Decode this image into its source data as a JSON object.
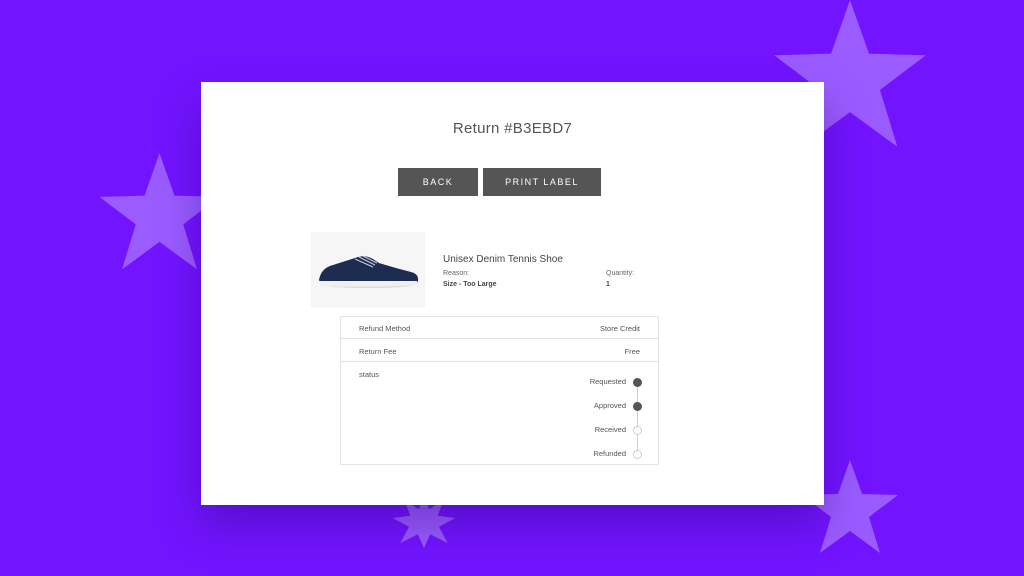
{
  "page": {
    "title": "Return #B3EBD7"
  },
  "actions": {
    "back_label": "BACK",
    "print_label": "PRINT LABEL"
  },
  "item": {
    "name": "Unisex Denim Tennis Shoe",
    "reason_label": "Reason:",
    "reason_value": "Size - Too Large",
    "quantity_label": "Quantity:",
    "quantity_value": "1"
  },
  "details": {
    "refund_method_label": "Refund Method",
    "refund_method_value": "Store Credit",
    "return_fee_label": "Return Fee",
    "return_fee_value": "Free",
    "status_label": "status",
    "steps": [
      {
        "label": "Requested",
        "done": true
      },
      {
        "label": "Approved",
        "done": true
      },
      {
        "label": "Received",
        "done": false
      },
      {
        "label": "Refunded",
        "done": false
      }
    ]
  },
  "colors": {
    "background": "#7214ff",
    "star": "#9b5cff",
    "button": "#555555",
    "shoe": "#1f2c52"
  },
  "icons": [
    "star-icon",
    "shoe-image",
    "timeline-dot-icon"
  ]
}
